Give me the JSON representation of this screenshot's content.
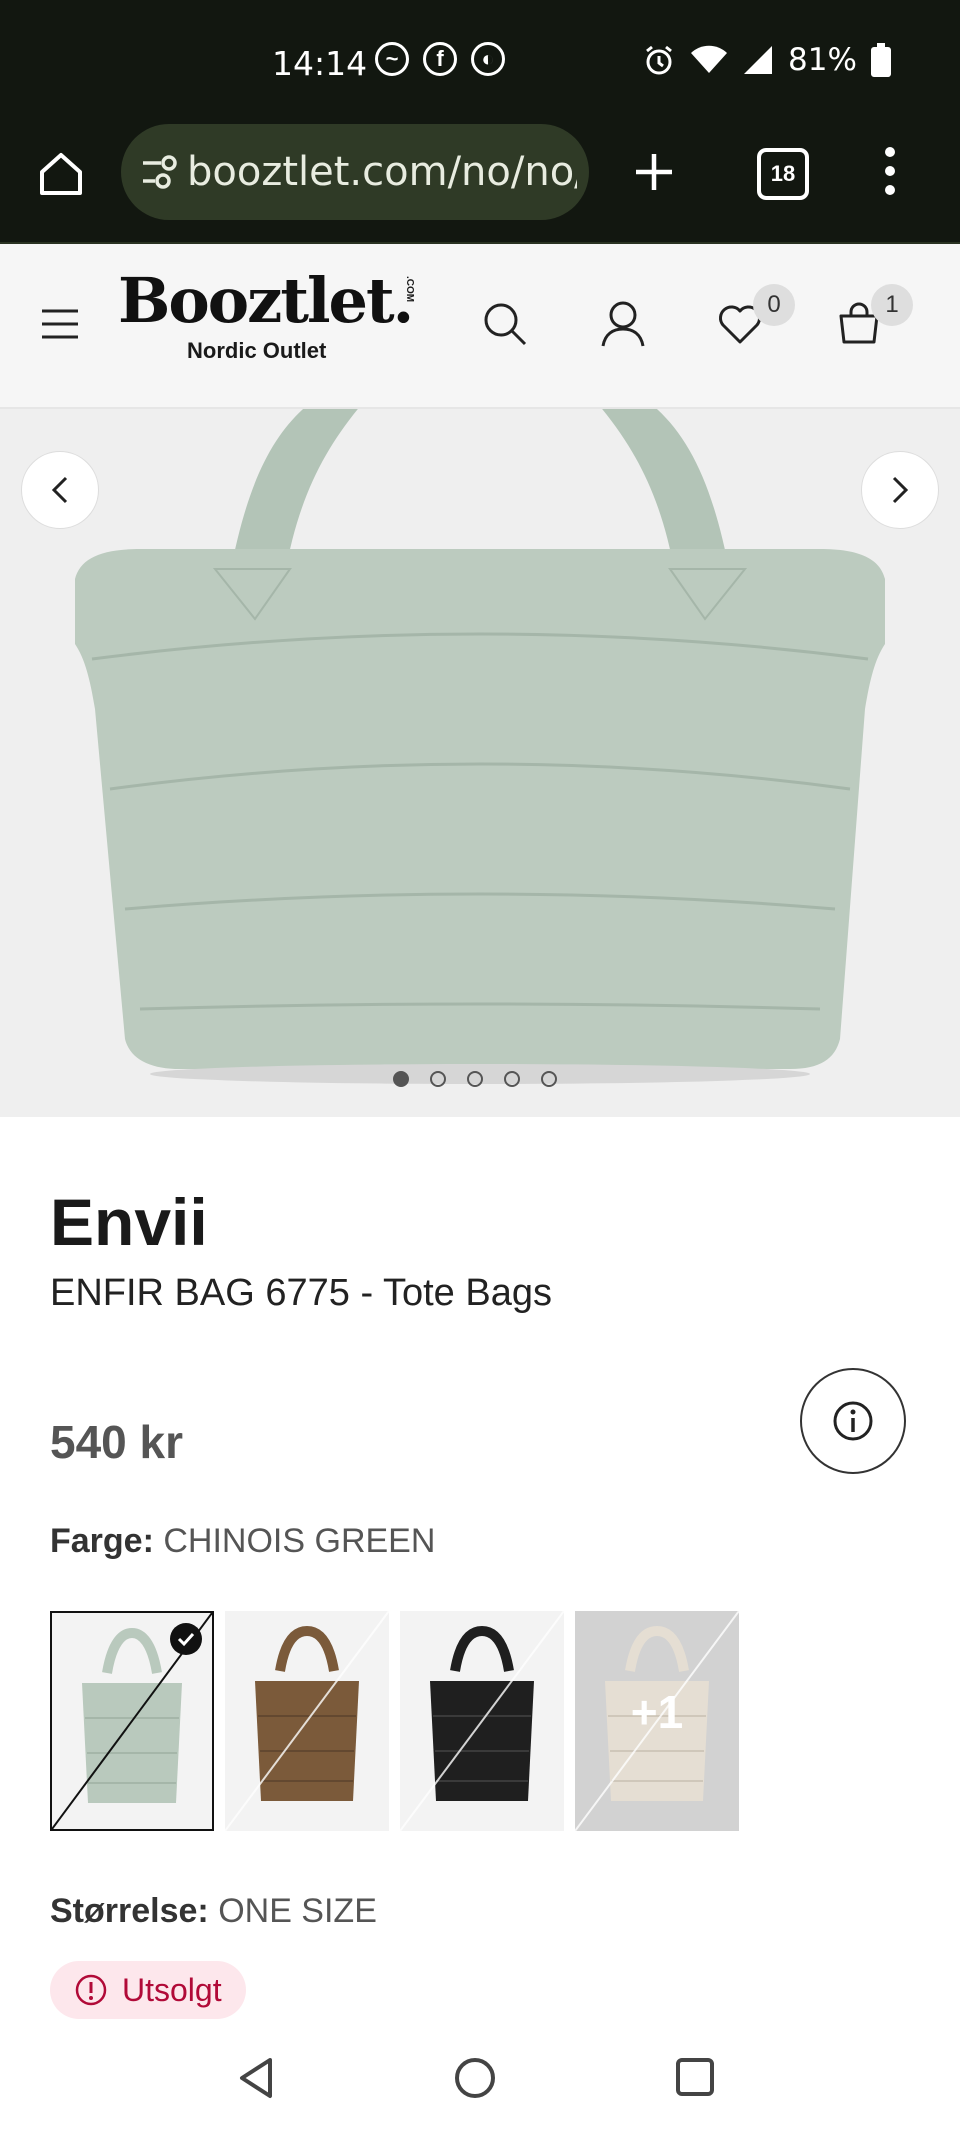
{
  "status_bar": {
    "time": "14:14",
    "battery": "81%"
  },
  "browser": {
    "url": "booztlet.com/no/no/",
    "tab_count": "18"
  },
  "header": {
    "logo_main": "Booztlet.",
    "logo_com": ".COM",
    "logo_sub": "Nordic Outlet",
    "wishlist_count": "0",
    "cart_count": "1"
  },
  "gallery": {
    "image_count": 5,
    "active_index": 0,
    "bag_color": "#b9c9bd"
  },
  "product": {
    "brand": "Envii",
    "name": "ENFIR BAG 6775 - Tote Bags",
    "price": "540 kr",
    "color_label": "Farge:",
    "color_value": "CHINOIS GREEN",
    "swatches": [
      {
        "color": "#b9c9bd",
        "selected": true
      },
      {
        "color": "#7b5a3a",
        "selected": false
      },
      {
        "color": "#1f1f1f",
        "selected": false
      },
      {
        "color": "#e5ded3",
        "selected": false,
        "more_label": "+1"
      }
    ],
    "size_label": "Størrelse:",
    "size_value": "ONE SIZE",
    "stock_status": "Utsolgt"
  },
  "colors": {
    "accent": "#b10a38",
    "status_bg": "#121710"
  }
}
